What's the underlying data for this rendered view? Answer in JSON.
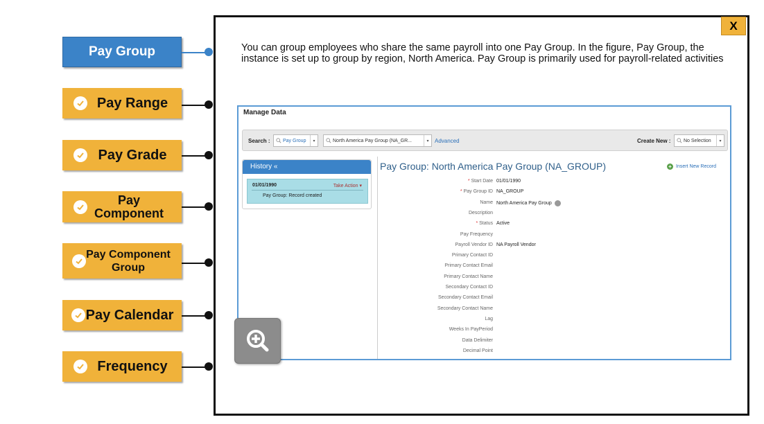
{
  "nav": {
    "items": [
      {
        "label": "Pay Group",
        "active": true
      },
      {
        "label": "Pay Range",
        "active": false
      },
      {
        "label": "Pay Grade",
        "active": false
      },
      {
        "label": "Pay Component",
        "active": false
      },
      {
        "label": "Pay Component Group",
        "active": false
      },
      {
        "label": "Pay Calendar",
        "active": false
      },
      {
        "label": "Frequency",
        "active": false
      }
    ]
  },
  "popup": {
    "close_label": "X",
    "description": "You can group employees who share the same payroll into one Pay Group. In the figure, Pay Group, the instance is set up to group by region, North America. Pay Group is primarily used for payroll-related activities"
  },
  "screenshot": {
    "title": "Manage Data",
    "search": {
      "label": "Search :",
      "type_value": "Pay Group",
      "instance_value": "North America Pay Group (NA_GR...",
      "advanced_link": "Advanced",
      "create_label": "Create New :",
      "create_value": "No Selection"
    },
    "history": {
      "header": "History «",
      "date": "01/01/1990",
      "action": "Take Action ▾",
      "note": "Pay Group: Record created"
    },
    "record_title": "Pay Group: North America Pay Group (NA_GROUP)",
    "insert_link": "Insert New Record",
    "fields": [
      {
        "label": "Start Date",
        "value": "01/01/1990",
        "required": true
      },
      {
        "label": "Pay Group ID",
        "value": "NA_GROUP",
        "required": true
      },
      {
        "label": "Name",
        "value": "North America Pay Group",
        "required": false,
        "info": true
      },
      {
        "label": "Description",
        "value": "",
        "required": false
      },
      {
        "label": "Status",
        "value": "Active",
        "required": true
      },
      {
        "label": "Pay Frequency",
        "value": "",
        "required": false
      },
      {
        "label": "Payroll Vendor ID",
        "value": "NA Payroll Vendor",
        "required": false
      },
      {
        "label": "Primary Contact ID",
        "value": "",
        "required": false
      },
      {
        "label": "Primary Contact Email",
        "value": "",
        "required": false
      },
      {
        "label": "Primary Contact Name",
        "value": "",
        "required": false
      },
      {
        "label": "Secondary Contact ID",
        "value": "",
        "required": false
      },
      {
        "label": "Secondary Contact Email",
        "value": "",
        "required": false
      },
      {
        "label": "Secondary Contact Name",
        "value": "",
        "required": false
      },
      {
        "label": "Lag",
        "value": "",
        "required": false
      },
      {
        "label": "Weeks In PayPeriod",
        "value": "",
        "required": false
      },
      {
        "label": "Data Delimiter",
        "value": "",
        "required": false
      },
      {
        "label": "Decimal Point",
        "value": "",
        "required": false
      }
    ]
  },
  "icons": {
    "check": "check-circle-icon",
    "zoom": "zoom-in-icon",
    "search": "search-icon",
    "info": "info-icon"
  },
  "colors": {
    "accent_orange": "#f0b23a",
    "accent_blue": "#3b83c8",
    "frame_blue": "#5b9bd5"
  }
}
